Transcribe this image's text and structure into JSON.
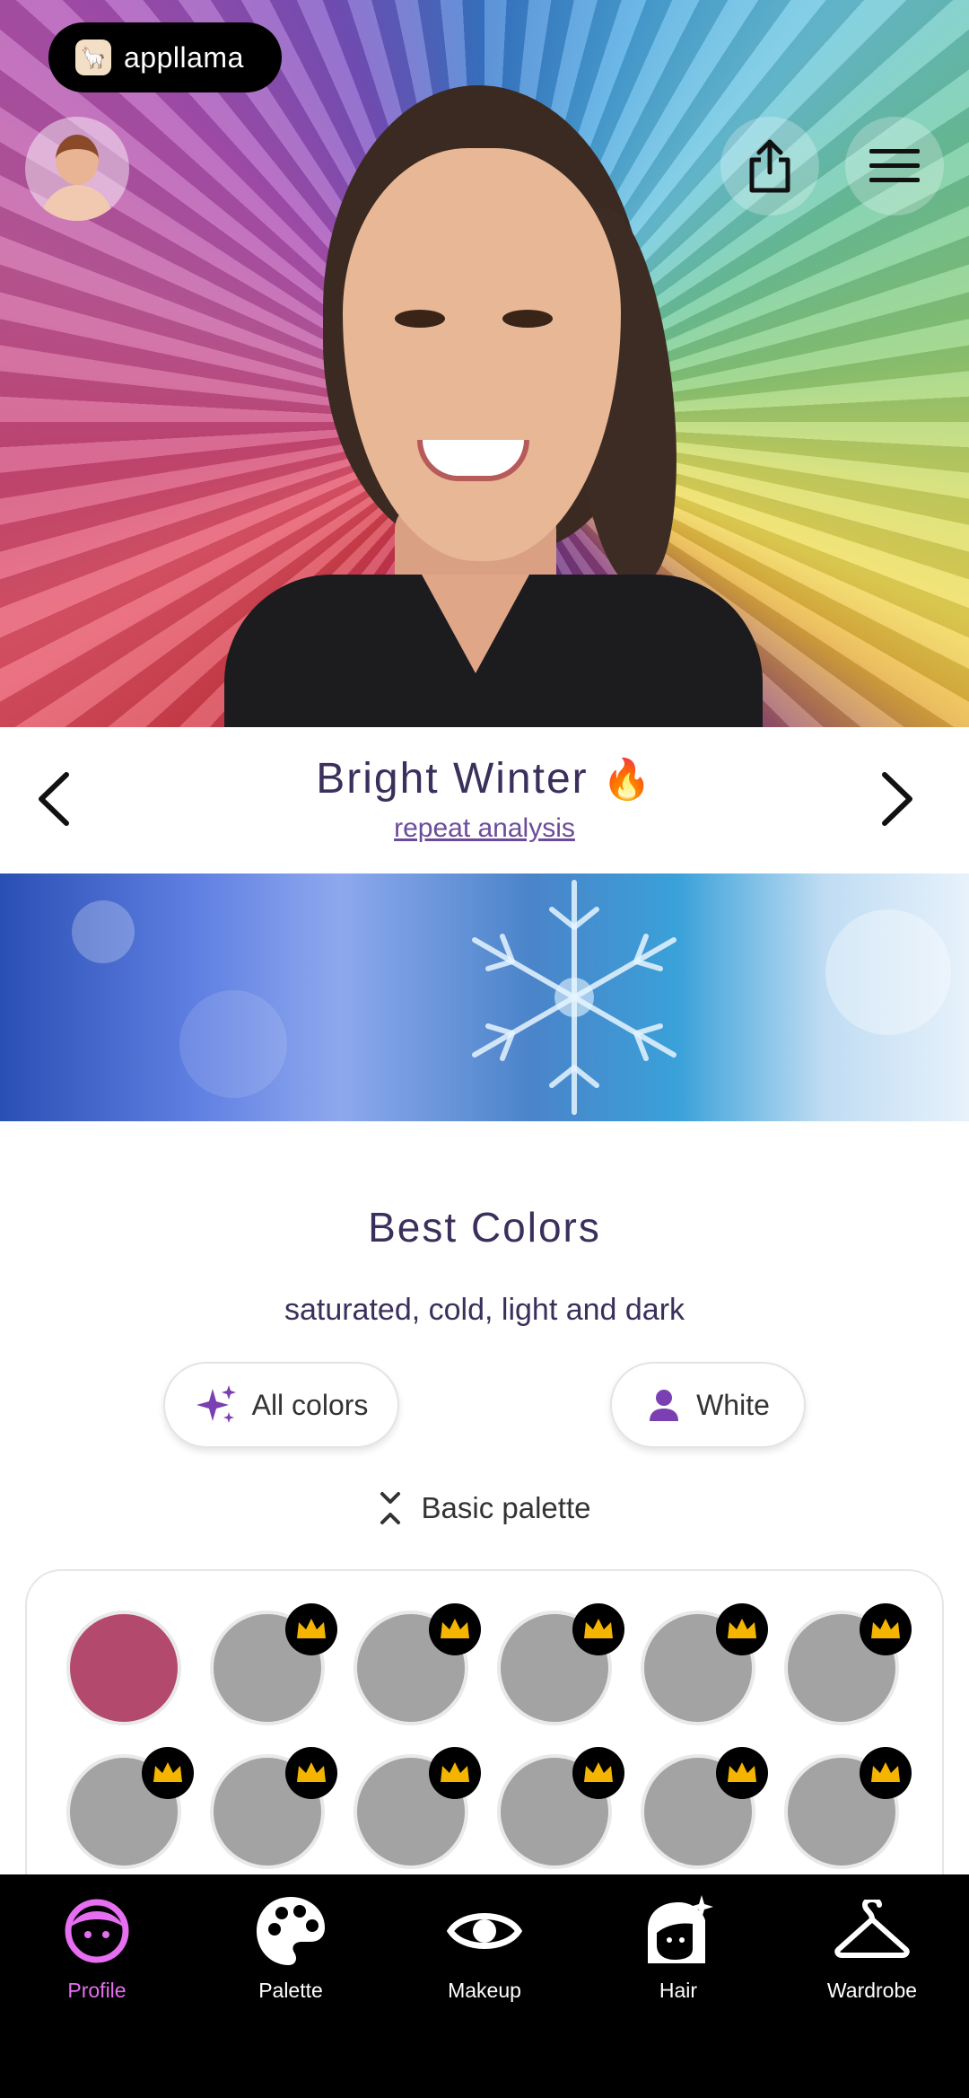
{
  "brand": {
    "name": "appllama",
    "logo_icon": "llama-logo-icon"
  },
  "header": {
    "share_icon": "share-icon",
    "menu_icon": "hamburger-menu-icon"
  },
  "season": {
    "title": "Bright Winter",
    "emoji": "🔥",
    "repeat_label": "repeat analysis",
    "prev_icon": "chevron-left-icon",
    "next_icon": "chevron-right-icon"
  },
  "best_colors": {
    "title": "Best Colors",
    "subtitle": "saturated, cold, light and dark",
    "filters": [
      {
        "label": "All colors",
        "icon": "sparkle-icon"
      },
      {
        "label": "White",
        "icon": "person-icon"
      }
    ],
    "palette_toggle": "Basic palette",
    "swatches": {
      "first_color": "#b34a6e",
      "locked_color": "#a3a3a3",
      "rows": 2,
      "per_row": 6
    }
  },
  "bottom_nav": [
    {
      "label": "Profile",
      "icon": "face-icon",
      "active": true
    },
    {
      "label": "Palette",
      "icon": "palette-icon",
      "active": false
    },
    {
      "label": "Makeup",
      "icon": "eye-icon",
      "active": false
    },
    {
      "label": "Hair",
      "icon": "hair-icon",
      "active": false
    },
    {
      "label": "Wardrobe",
      "icon": "hanger-icon",
      "active": false
    }
  ],
  "colors": {
    "accent": "#e66ef0",
    "title": "#3b2f5c",
    "link": "#6b4c9a",
    "crown": "#f4b400"
  }
}
